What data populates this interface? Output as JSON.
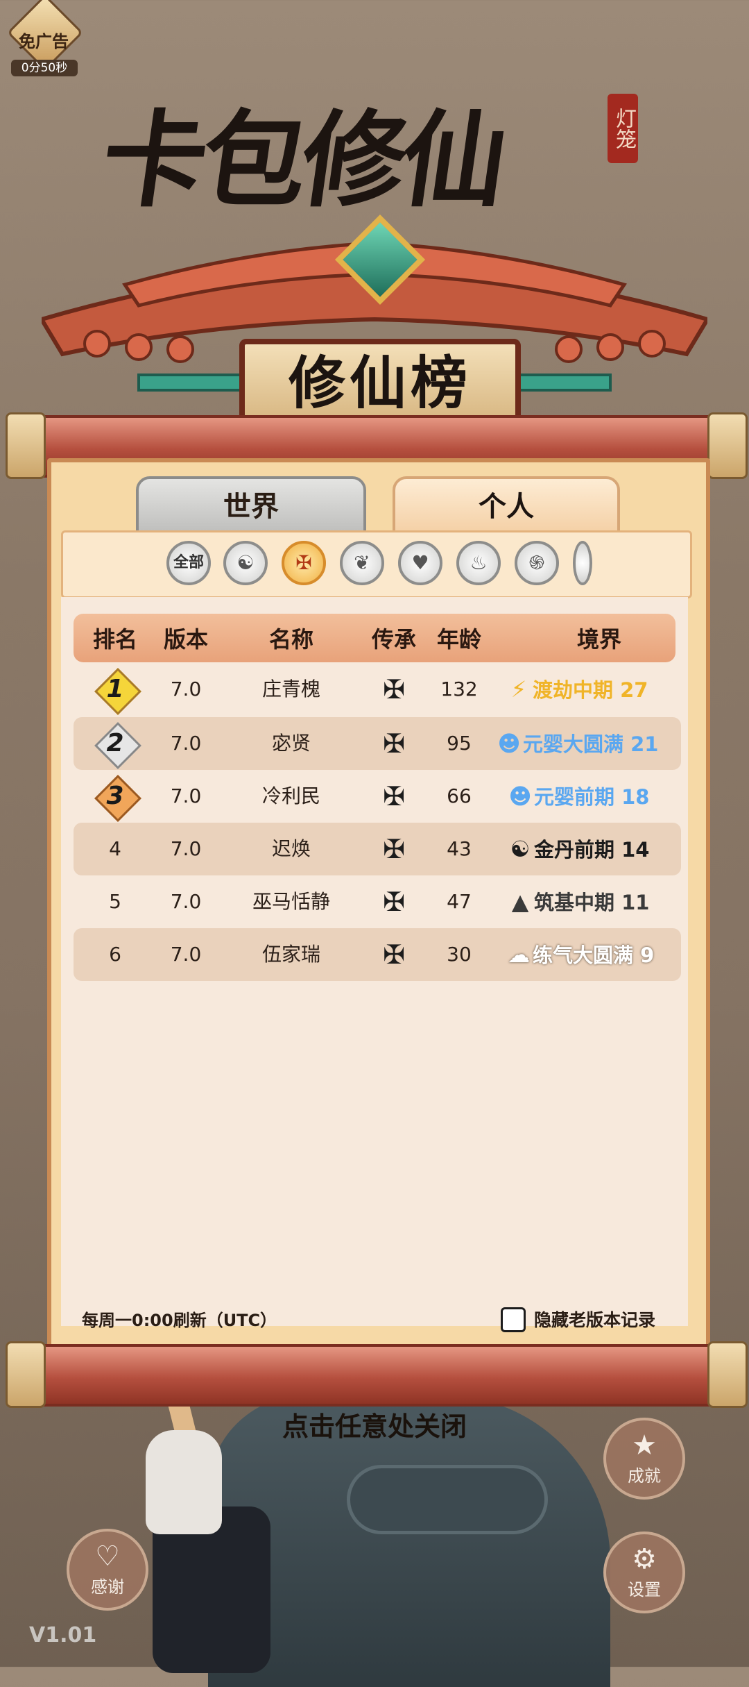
{
  "ad_badge": {
    "label": "免广告",
    "timer": "0分50秒"
  },
  "title": {
    "main": "卡包修仙",
    "seal": "灯笼",
    "plaque": "修仙榜"
  },
  "tabs": [
    {
      "label": "世界",
      "active": false
    },
    {
      "label": "个人",
      "active": true
    }
  ],
  "filters": [
    {
      "label": "全部",
      "icon": "all"
    },
    {
      "label": "",
      "icon": "yin-yang-icon"
    },
    {
      "label": "",
      "icon": "sword-emblem-icon",
      "active": true
    },
    {
      "label": "",
      "icon": "lotus-icon"
    },
    {
      "label": "",
      "icon": "heart-icon"
    },
    {
      "label": "",
      "icon": "flame-icon"
    },
    {
      "label": "",
      "icon": "spiral-icon"
    }
  ],
  "table": {
    "columns": [
      "排名",
      "版本",
      "名称",
      "传承",
      "年龄",
      "境界"
    ],
    "rows": [
      {
        "rank": "1",
        "version": "7.0",
        "name": "庄青槐",
        "age": "132",
        "realm": "渡劫中期 27",
        "realm_color": "#f0b428",
        "realm_icon": "lightning-icon"
      },
      {
        "rank": "2",
        "version": "7.0",
        "name": "宓贤",
        "age": "95",
        "realm": "元婴大圆满 21",
        "realm_color": "#5aa7f0",
        "realm_icon": "infant-icon"
      },
      {
        "rank": "3",
        "version": "7.0",
        "name": "冷利民",
        "age": "66",
        "realm": "元婴前期 18",
        "realm_color": "#5aa7f0",
        "realm_icon": "infant-icon"
      },
      {
        "rank": "4",
        "version": "7.0",
        "name": "迟焕",
        "age": "43",
        "realm": "金丹前期 14",
        "realm_color": "#1c1c1c",
        "realm_icon": "taiji-icon"
      },
      {
        "rank": "5",
        "version": "7.0",
        "name": "巫马恬静",
        "age": "47",
        "realm": "筑基中期 11",
        "realm_color": "#3a3a3a",
        "realm_icon": "meditation-icon"
      },
      {
        "rank": "6",
        "version": "7.0",
        "name": "伍家瑞",
        "age": "30",
        "realm": "练气大圆满 9",
        "realm_color": "#ffffff",
        "realm_icon": "cloud-icon"
      }
    ]
  },
  "footer": {
    "refresh_note": "每周一0:00刷新（UTC）",
    "hide_old_label": "隐藏老版本记录",
    "hide_old_checked": false
  },
  "close_hint": "点击任意处关闭",
  "buttons": {
    "achievement": "成就",
    "settings": "设置",
    "thanks": "感谢"
  },
  "version": "V1.01",
  "colors": {
    "rank1": "#f5d53a",
    "rank2": "#e6e6e6",
    "rank3": "#f1a65a",
    "panel": "#f6d9a6",
    "scroll_red": "#b54f3e"
  }
}
